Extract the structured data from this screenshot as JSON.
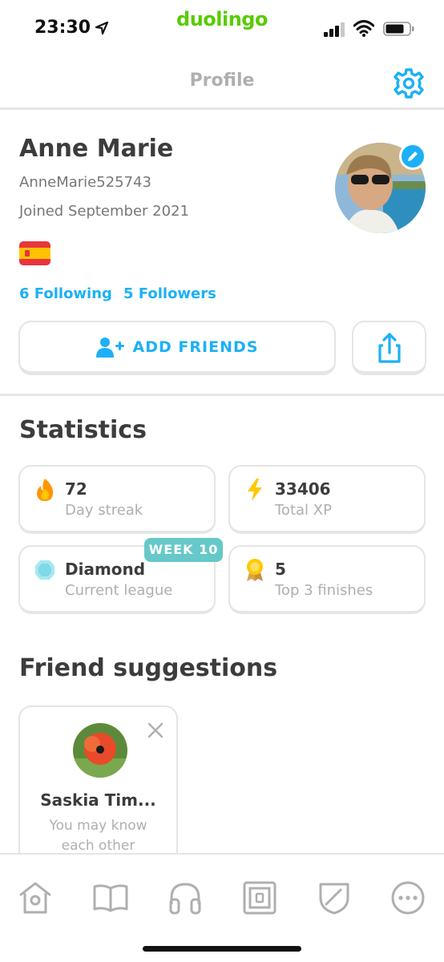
{
  "status_bar": {
    "time": "23:30",
    "carrier": "duolingo"
  },
  "header": {
    "title": "Profile"
  },
  "profile": {
    "name": "Anne Marie",
    "username": "AnneMarie525743",
    "joined": "Joined September 2021",
    "following": "6 Following",
    "followers": "5 Followers",
    "flag": "spain-flag-icon"
  },
  "actions": {
    "add_friends": "ADD FRIENDS"
  },
  "statistics": {
    "title": "Statistics",
    "streak": {
      "value": "72",
      "label": "Day streak"
    },
    "xp": {
      "value": "33406",
      "label": "Total XP"
    },
    "league": {
      "value": "Diamond",
      "label": "Current league",
      "badge": "WEEK 10"
    },
    "top3": {
      "value": "5",
      "label": "Top 3 finishes"
    }
  },
  "friend_suggestions": {
    "title": "Friend suggestions",
    "items": [
      {
        "name": "Saskia Tim...",
        "subtitle_line1": "You may know",
        "subtitle_line2": "each other"
      }
    ]
  },
  "tabs": [
    {
      "icon": "home-icon"
    },
    {
      "icon": "book-icon"
    },
    {
      "icon": "headphones-icon"
    },
    {
      "icon": "stories-icon"
    },
    {
      "icon": "shield-icon"
    },
    {
      "icon": "more-icon"
    }
  ],
  "colors": {
    "accent": "#1cb0f6",
    "brand": "#58cc02",
    "badge": "#66c8c8",
    "streak": "#ff9600",
    "xp": "#ffc800"
  }
}
